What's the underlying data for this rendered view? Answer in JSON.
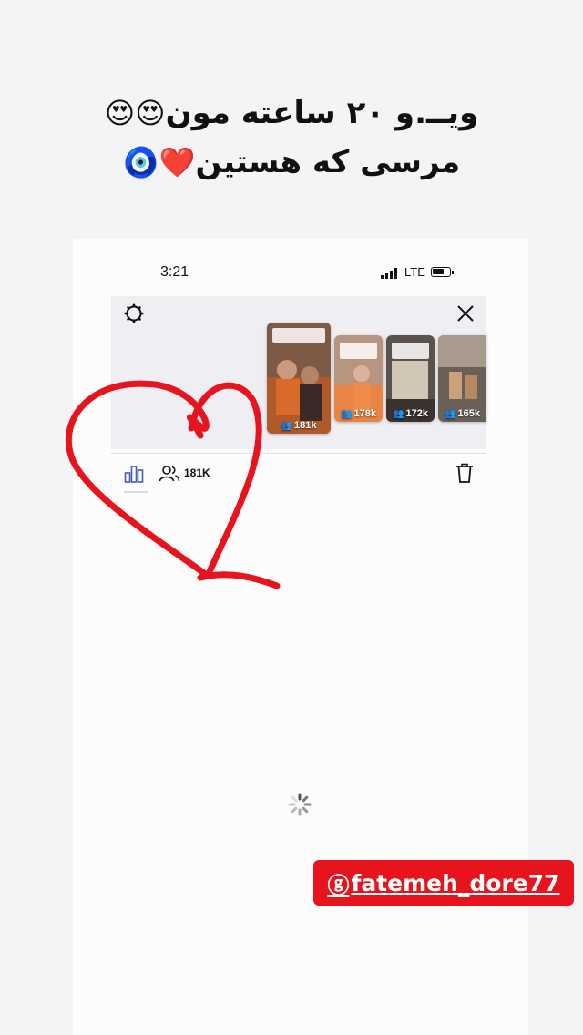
{
  "story_caption": {
    "line1_text": "ویــ.و ۲۰ ساعته مون",
    "line1_emoji": "😍😍",
    "line2_text": "مرسی که هستین",
    "line2_emoji": "❤️🧿"
  },
  "status_bar": {
    "time": "3:21",
    "network": "LTE"
  },
  "story_viewer": {
    "thumbnails": [
      {
        "views": "181k",
        "color": "#9c6f4d"
      },
      {
        "views": "178k",
        "color": "#c98c63"
      },
      {
        "views": "172k",
        "color": "#6d5f55"
      },
      {
        "views": "165k",
        "color": "#8a7766"
      }
    ],
    "viewer_count": "181K",
    "icons": [
      "settings-icon",
      "close-icon",
      "bar-chart-icon",
      "people-icon",
      "trash-icon",
      "loading-spinner-icon"
    ]
  },
  "overlay": {
    "handle": "fatemeh_dore77",
    "heart_color": "#e8141d"
  }
}
